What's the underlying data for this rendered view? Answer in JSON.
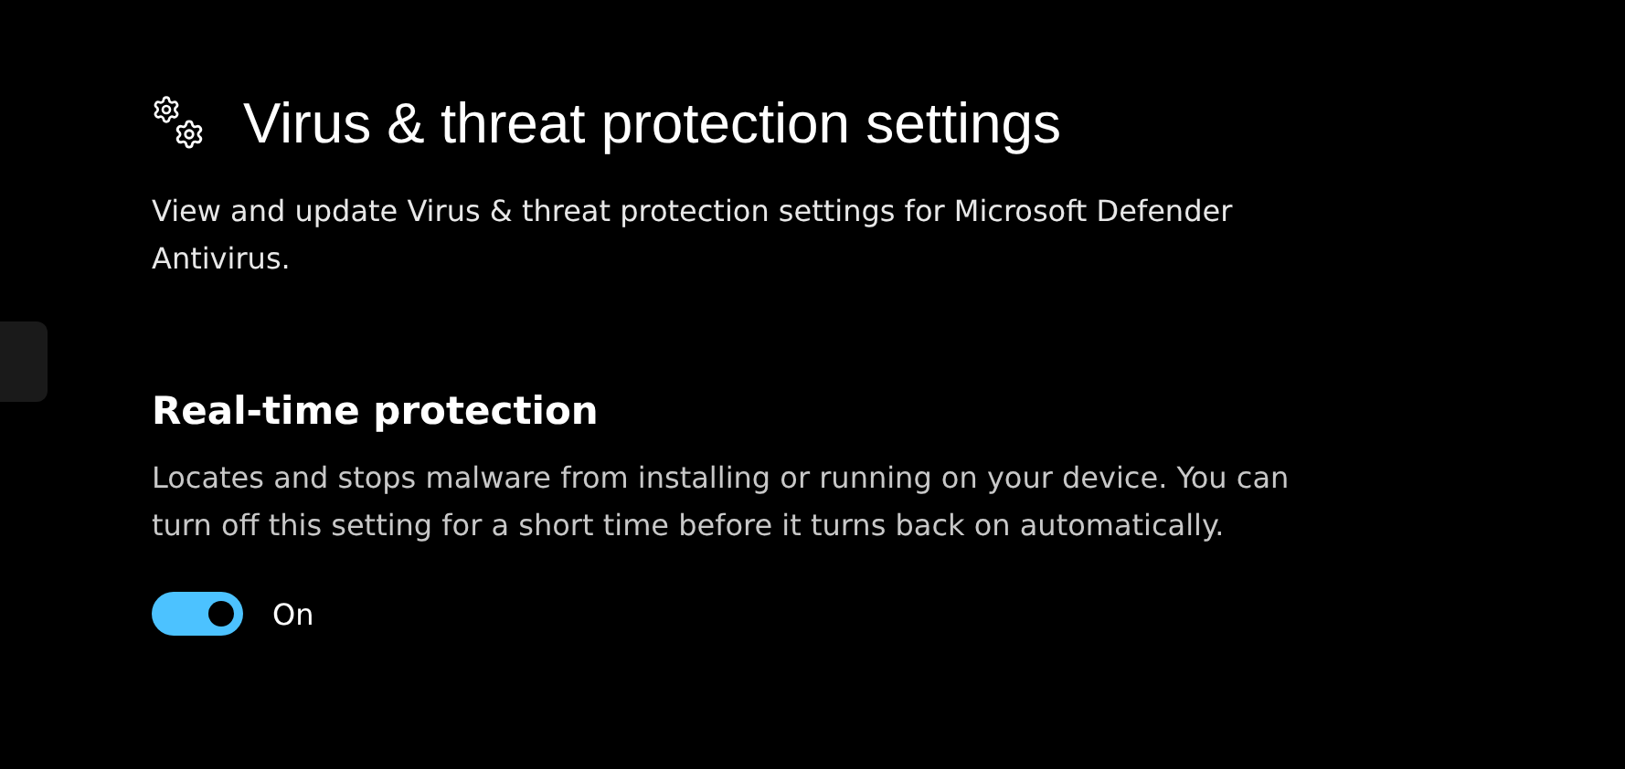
{
  "page": {
    "title": "Virus & threat protection settings",
    "description": "View and update Virus & threat protection settings for Microsoft Defender Antivirus."
  },
  "setting": {
    "heading": "Real-time protection",
    "description": "Locates and stops malware from installing or running on your device. You can turn off this setting for a short time before it turns back on automatically.",
    "toggle": {
      "on": true,
      "label": "On"
    }
  }
}
